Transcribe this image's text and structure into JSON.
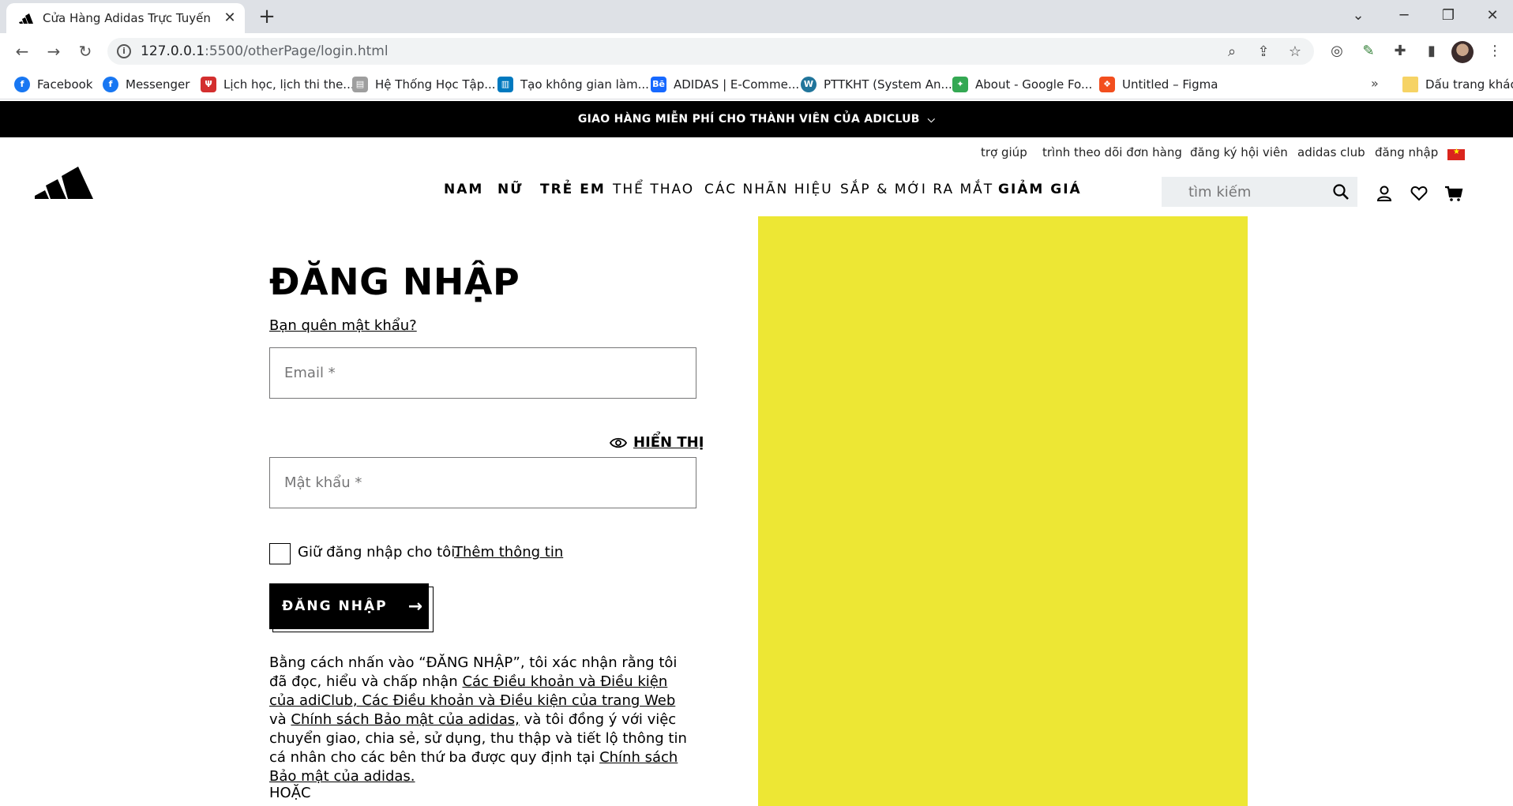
{
  "browser": {
    "tab_title": "Cửa Hàng Adidas Trực Tuyến | adidas",
    "url_host": "127.0.0.1",
    "url_path": ":5500/otherPage/login.html",
    "new_tab": "+",
    "close": "✕",
    "minimize": "─",
    "restore": "❐",
    "close_window": "✕",
    "dropdown": "⌄",
    "bookmarks": [
      {
        "label": "Facebook",
        "color": "#1877f2"
      },
      {
        "label": "Messenger",
        "color": "#1877f2"
      },
      {
        "label": "Lịch học, lịch thi the...",
        "color": "#d32f2f"
      },
      {
        "label": "Hệ Thống Học Tập...",
        "color": "#9e9e9e"
      },
      {
        "label": "Tạo không gian làm...",
        "color": "#0079bf"
      },
      {
        "label": "ADIDAS | E-Comme...",
        "color": "#1769ff"
      },
      {
        "label": "PTTKHT (System An...",
        "color": "#21759b"
      },
      {
        "label": "About - Google Fo...",
        "color": "#34a853"
      },
      {
        "label": "Untitled – Figma",
        "color": "#f24e1e"
      }
    ],
    "bookmark_more": "»",
    "other_bookmarks": "Dấu trang khác"
  },
  "promo": {
    "text": "GIAO HÀNG MIỄN PHÍ CHO THÀNH VIÊN CỦA ADICLUB"
  },
  "utility_nav": {
    "help": "trợ giúp",
    "track_order": "trình theo dõi đơn hàng",
    "register": "đăng ký hội viên",
    "club": "adidas club",
    "login": "đăng nhập"
  },
  "main_nav": {
    "men": "NAM",
    "women": "NỮ",
    "kids": "TRẺ EM",
    "sports": "THỂ THAO",
    "brands": "CÁC NHÃN HIỆU",
    "new": "SẮP & MỚI RA MẮT",
    "sale": "GIẢM GIÁ"
  },
  "search": {
    "placeholder": "tìm kiếm"
  },
  "login": {
    "title": "ĐĂNG NHẬP",
    "forgot": "Bạn quên mật khẩu?",
    "email_placeholder": "Email *",
    "show_password": "HIỂN THỊ",
    "password_placeholder": "Mật khẩu *",
    "keep_logged_in": "Giữ đăng nhập cho tôi.",
    "more_info": "Thêm thông tin",
    "button": "ĐĂNG NHẬP",
    "button_arrow": "→",
    "legal_1": "Bằng cách nhấn vào “ĐĂNG NHẬP”, tôi xác nhận rằng tôi đã đọc, hiểu và chấp nhận ",
    "legal_link_1": "Các Điều khoản và Điều kiện của adiClub, Các Điều khoản và Điều kiện của trang Web",
    "legal_2": " và ",
    "legal_link_2": "Chính sách Bảo mật của adidas,",
    "legal_3": " và tôi đồng ý với việc chuyển giao, chia sẻ, sử dụng, thu thập và tiết lộ thông tin cá nhân cho các bên thứ ba được quy định tại ",
    "legal_link_3": "Chính sách Bảo mật của adidas.",
    "or": "HOẶC"
  },
  "colors": {
    "promo_bg": "#000000",
    "panel_yellow": "#ede734",
    "search_bg": "#eceff1"
  }
}
